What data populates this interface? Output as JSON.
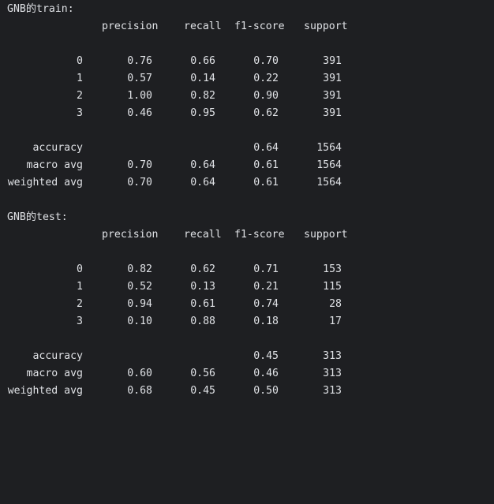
{
  "console": {
    "background": "#1e1f22",
    "text_color": "#dfe1e5",
    "reports": [
      {
        "title": "GNB的train:",
        "headers": {
          "precision": "precision",
          "recall": "recall",
          "f1": "f1-score",
          "support": "support"
        },
        "classes": [
          {
            "label": "0",
            "precision": "0.76",
            "recall": "0.66",
            "f1": "0.70",
            "support": "391"
          },
          {
            "label": "1",
            "precision": "0.57",
            "recall": "0.14",
            "f1": "0.22",
            "support": "391"
          },
          {
            "label": "2",
            "precision": "1.00",
            "recall": "0.82",
            "f1": "0.90",
            "support": "391"
          },
          {
            "label": "3",
            "precision": "0.46",
            "recall": "0.95",
            "f1": "0.62",
            "support": "391"
          }
        ],
        "accuracy": {
          "label": "accuracy",
          "f1": "0.64",
          "support": "1564"
        },
        "macro": {
          "label": "macro avg",
          "precision": "0.70",
          "recall": "0.64",
          "f1": "0.61",
          "support": "1564"
        },
        "weighted": {
          "label": "weighted avg",
          "precision": "0.70",
          "recall": "0.64",
          "f1": "0.61",
          "support": "1564"
        }
      },
      {
        "title": "GNB的test:",
        "headers": {
          "precision": "precision",
          "recall": "recall",
          "f1": "f1-score",
          "support": "support"
        },
        "classes": [
          {
            "label": "0",
            "precision": "0.82",
            "recall": "0.62",
            "f1": "0.71",
            "support": "153"
          },
          {
            "label": "1",
            "precision": "0.52",
            "recall": "0.13",
            "f1": "0.21",
            "support": "115"
          },
          {
            "label": "2",
            "precision": "0.94",
            "recall": "0.61",
            "f1": "0.74",
            "support": "28"
          },
          {
            "label": "3",
            "precision": "0.10",
            "recall": "0.88",
            "f1": "0.18",
            "support": "17"
          }
        ],
        "accuracy": {
          "label": "accuracy",
          "f1": "0.45",
          "support": "313"
        },
        "macro": {
          "label": "macro avg",
          "precision": "0.60",
          "recall": "0.56",
          "f1": "0.46",
          "support": "313"
        },
        "weighted": {
          "label": "weighted avg",
          "precision": "0.68",
          "recall": "0.45",
          "f1": "0.50",
          "support": "313"
        }
      }
    ]
  }
}
